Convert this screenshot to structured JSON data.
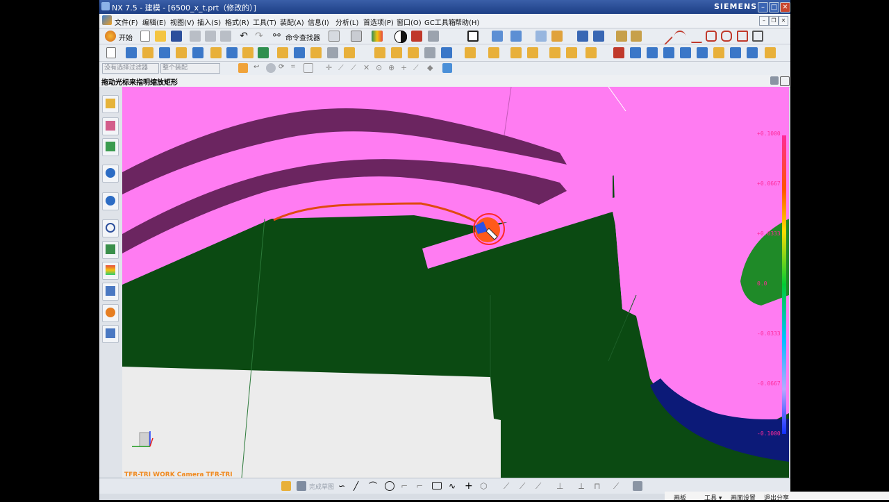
{
  "window": {
    "title": "NX 7.5 - 建模 - [6500_x_t.prt（修改的）]",
    "brand": "SIEMENS"
  },
  "menubar": {
    "items": [
      "文件(F)",
      "编辑(E)",
      "视图(V)",
      "插入(S)",
      "格式(R)",
      "工具(T)",
      "装配(A)",
      "信息(I)",
      "分析(L)",
      "首选项(P)",
      "窗口(O)",
      "GC工具箱",
      "帮助(H)"
    ]
  },
  "toolbar": {
    "start_label": "开始",
    "command_finder_label": "命令查找器"
  },
  "filters": {
    "type_filter": "没有选择过滤器",
    "assembly_filter": "整个装配"
  },
  "hint": "拖动光标来指明缩放矩形",
  "viewport": {
    "camera_label": "TFR-TRI WORK Camera TFR-TRI",
    "colorbar_ticks": [
      "+0.1000",
      "+0.0667",
      "+0.0333",
      "0.0",
      "-0.0333",
      "-0.0667",
      "-0.1000"
    ],
    "colors": {
      "surface_pink": "#ff7cf2",
      "dark_purple": "#6b2560",
      "dark_green": "#0b4a12",
      "light_gray": "#ececec",
      "navy": "#0c1a78",
      "annotation": "#e04a10"
    }
  },
  "statusbar": {
    "sketch_finish_label": "完成草图"
  },
  "taskbar": {
    "items": [
      "画板",
      "工具 ▾",
      "画面设置",
      "退出分享"
    ]
  }
}
